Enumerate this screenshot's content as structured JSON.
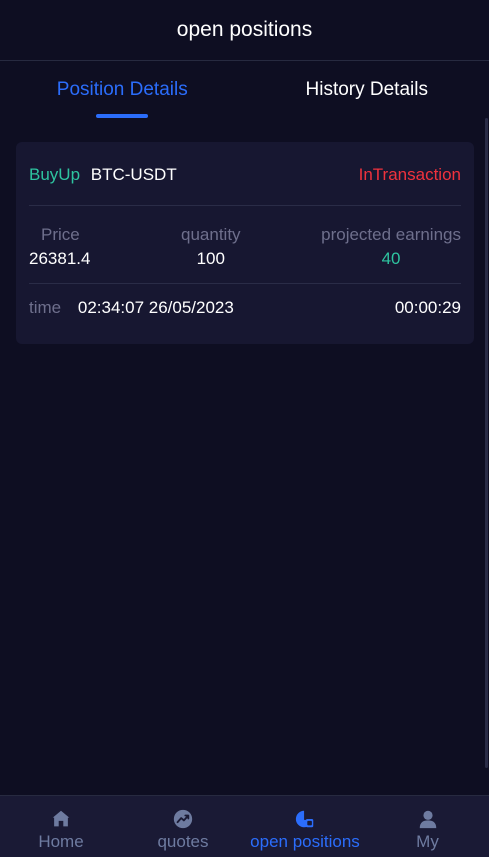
{
  "header": {
    "title": "open positions"
  },
  "tabs": [
    {
      "label": "Position Details",
      "active": true
    },
    {
      "label": "History Details",
      "active": false
    }
  ],
  "position": {
    "direction": "BuyUp",
    "pair": "BTC-USDT",
    "status": "InTransaction",
    "price_label": "Price",
    "price_value": "26381.4",
    "quantity_label": "quantity",
    "quantity_value": "100",
    "earnings_label": "projected earnings",
    "earnings_value": "40",
    "time_label": "time",
    "time_value": "02:34:07 26/05/2023",
    "elapsed": "00:00:29"
  },
  "nav": [
    {
      "label": "Home",
      "icon": "home-icon",
      "active": false
    },
    {
      "label": "quotes",
      "icon": "chart-trend-icon",
      "active": false
    },
    {
      "label": "open positions",
      "icon": "pie-chart-icon",
      "active": true
    },
    {
      "label": "My",
      "icon": "user-icon",
      "active": false
    }
  ],
  "colors": {
    "background": "#0e0e22",
    "card": "#171731",
    "accent": "#2b6dfb",
    "up": "#2ec4a0",
    "down": "#f0323d",
    "muted": "#6e6f8c"
  }
}
